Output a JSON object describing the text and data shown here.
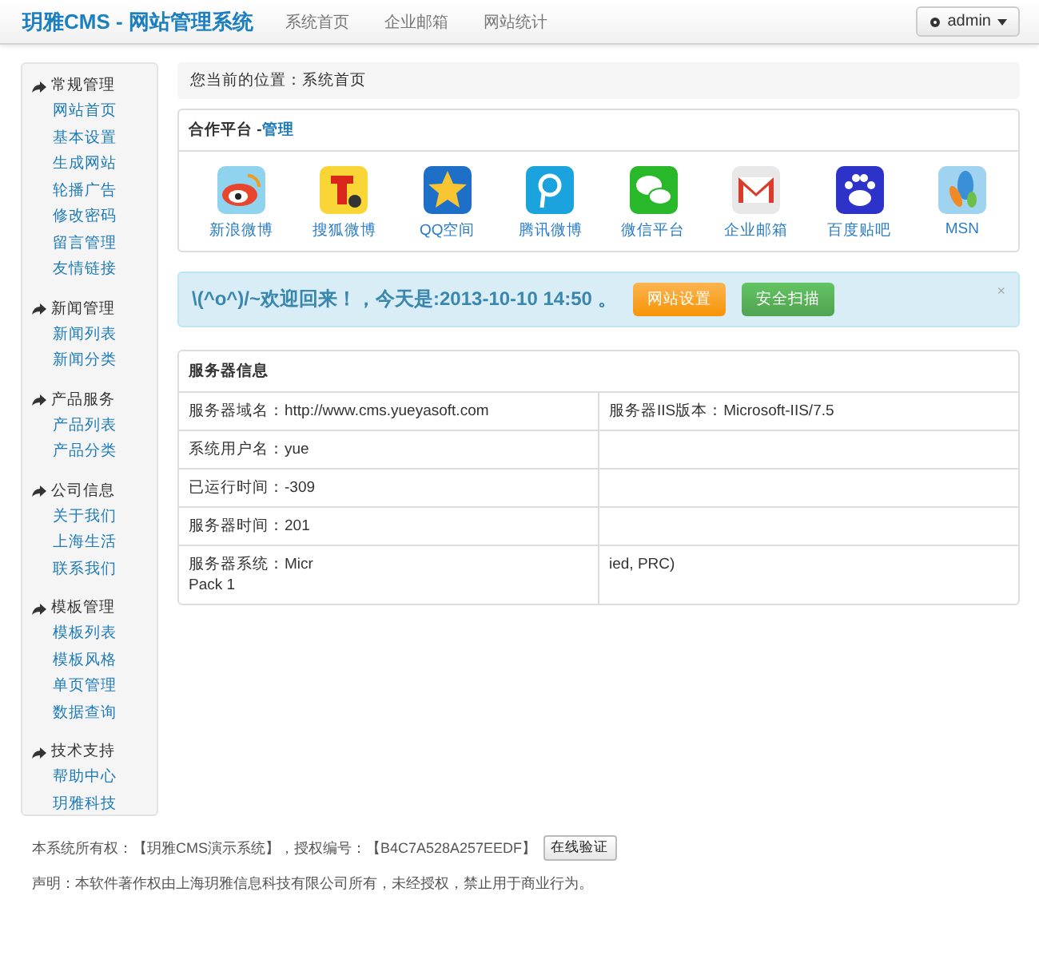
{
  "header": {
    "brand": "玥雅CMS - 网站管理系统",
    "nav": [
      {
        "label": "系统首页"
      },
      {
        "label": "企业邮箱"
      },
      {
        "label": "网站统计"
      }
    ],
    "user": "admin"
  },
  "sidebar": {
    "groups": [
      {
        "title": "常规管理",
        "items": [
          "网站首页",
          "基本设置",
          "生成网站",
          "轮播广告",
          "修改密码",
          "留言管理",
          "友情链接"
        ]
      },
      {
        "title": "新闻管理",
        "items": [
          "新闻列表",
          "新闻分类"
        ]
      },
      {
        "title": "产品服务",
        "items": [
          "产品列表",
          "产品分类"
        ]
      },
      {
        "title": "公司信息",
        "items": [
          "关于我们",
          "上海生活",
          "联系我们"
        ]
      },
      {
        "title": "模板管理",
        "items": [
          "模板列表",
          "模板风格",
          "单页管理",
          "数据查询"
        ]
      },
      {
        "title": "技术支持",
        "items": [
          "帮助中心",
          "玥雅科技"
        ]
      }
    ]
  },
  "breadcrumb": "您当前的位置：系统首页",
  "partners": {
    "title": "合作平台 - ",
    "manage_link": "管理",
    "items": [
      {
        "label": "新浪微博"
      },
      {
        "label": "搜狐微博"
      },
      {
        "label": "QQ空间"
      },
      {
        "label": "腾讯微博"
      },
      {
        "label": "微信平台"
      },
      {
        "label": "企业邮箱"
      },
      {
        "label": "百度贴吧"
      },
      {
        "label": "MSN"
      }
    ]
  },
  "welcome": {
    "text": "\\(^o^)/~欢迎回来！，今天是:2013-10-10 14:50 。",
    "buttons": [
      {
        "label": "网站设置",
        "kind": "warning"
      },
      {
        "label": "安全扫描",
        "kind": "success"
      }
    ],
    "close": "×"
  },
  "server_info": {
    "title": "服务器信息",
    "rows": [
      {
        "left": "服务器域名：http://www.cms.yueyasoft.com",
        "right": "服务器IIS版本：Microsoft-IIS/7.5"
      },
      {
        "left": "系统用户名：yue"
      },
      {
        "left": "已运行时间：-309"
      },
      {
        "left": "服务器时间：201"
      },
      {
        "left": "服务器系统：Micr",
        "left_more": "Pack 1",
        "right": "ied, PRC)"
      }
    ]
  },
  "footer": {
    "owner": "本系统所有权：【玥雅CMS演示系统】，授权编号：【B4C7A528A257EEDF】",
    "verify_button": "在线验证",
    "notice": "声明：本软件著作权由上海玥雅信息科技有限公司所有，未经授权，禁止用于商业行为。"
  }
}
